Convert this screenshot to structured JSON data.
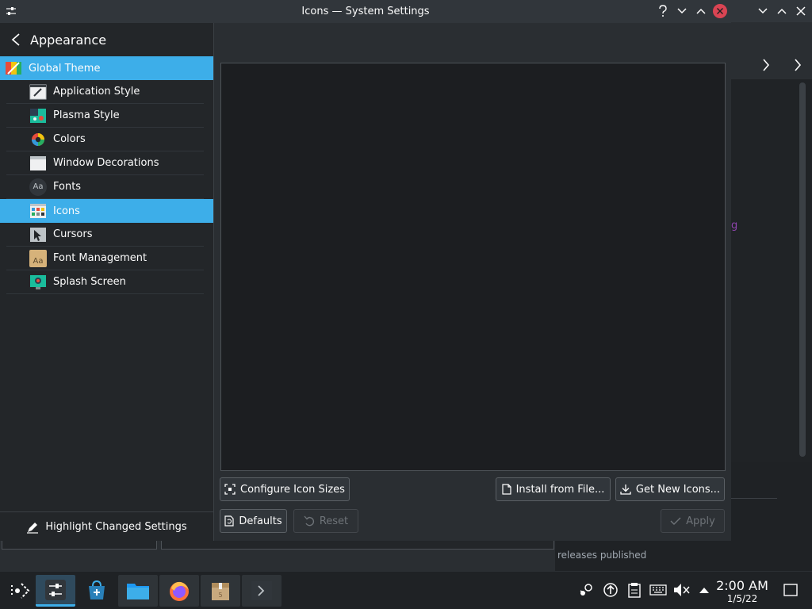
{
  "window": {
    "title": "Icons — System Settings",
    "buttons": [
      "help-icon",
      "minimize-icon",
      "maximize-icon",
      "close-icon"
    ]
  },
  "sidebar": {
    "header": "Appearance",
    "global_item": {
      "label": "Global Theme",
      "icon": "global-theme-icon"
    },
    "items": [
      {
        "label": "Application Style",
        "icon": "application-style-icon"
      },
      {
        "label": "Plasma Style",
        "icon": "plasma-style-icon"
      },
      {
        "label": "Colors",
        "icon": "colors-icon"
      },
      {
        "label": "Window Decorations",
        "icon": "window-decorations-icon"
      },
      {
        "label": "Fonts",
        "icon": "fonts-icon",
        "icon_text": "Aa"
      },
      {
        "label": "Icons",
        "icon": "icons-icon",
        "selected": true
      },
      {
        "label": "Cursors",
        "icon": "cursors-icon"
      },
      {
        "label": "Font Management",
        "icon": "font-management-icon",
        "icon_text": "Aa"
      },
      {
        "label": "Splash Screen",
        "icon": "splash-screen-icon"
      }
    ],
    "highlight_changed": "Highlight Changed Settings"
  },
  "content": {
    "configure_sizes": "Configure Icon Sizes",
    "install_from_file": "Install from File...",
    "get_new_icons": "Get New Icons...",
    "defaults": "Defaults",
    "reset": "Reset",
    "apply": "Apply"
  },
  "background_window": {
    "purple_text": "g",
    "releases_text": "releases published"
  },
  "taskbar": {
    "apps": [
      "application-launcher-icon",
      "system-settings-icon",
      "discover-store-icon",
      "file-manager-icon",
      "firefox-icon",
      "package-icon",
      "terminal-icon"
    ],
    "tray": [
      "steam-icon",
      "updates-icon",
      "clipboard-icon",
      "keyboard-icon",
      "volume-muted-icon",
      "tray-expand-icon",
      "show-desktop-icon"
    ],
    "clock": {
      "time": "2:00 AM",
      "date": "1/5/22"
    }
  },
  "colors": {
    "accent": "#3daee9",
    "window_bg": "#2a2e32",
    "sidebar_bg": "#232629",
    "grid_bg": "#1c1e21",
    "close_button": "#da4453"
  }
}
